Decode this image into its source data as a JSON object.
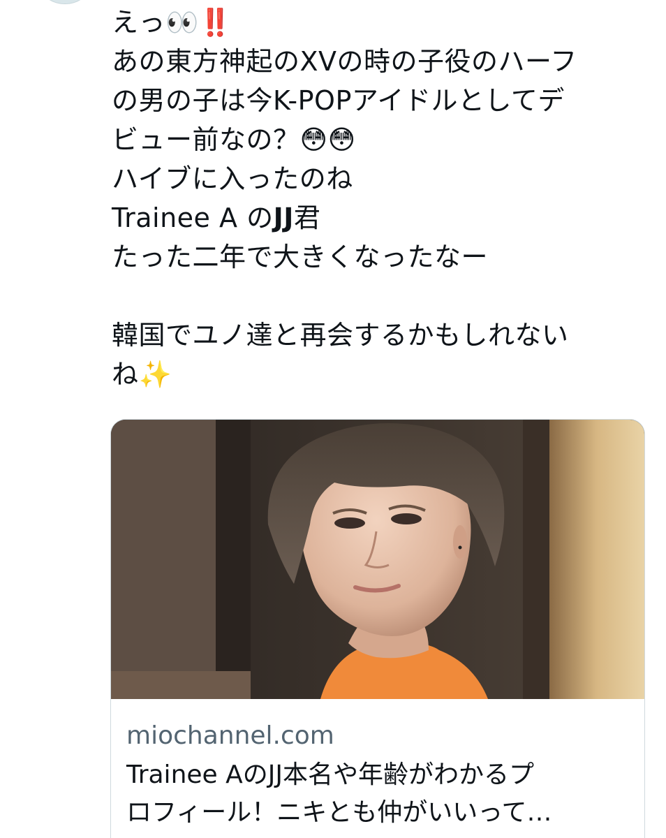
{
  "tweet": {
    "lines": [
      "えっ👀‼️",
      "あの東方神起のXVの時の子役のハーフ",
      "の男の子は今K-POPアイドルとしてデ",
      "ビュー前なの？😳😳",
      "ハイブに入ったのね",
      "Trainee A の",
      "JJ",
      "君",
      "たった二年で大きくなったなー",
      "",
      "韓国でユノ達と再会するかもしれない",
      "ね✨"
    ]
  },
  "card": {
    "domain": "miochannel.com",
    "headline_lines": [
      "Trainee AのJJ本名や年齢がわかるプ",
      "ロフィール！ニキとも仲がいいって…"
    ]
  }
}
